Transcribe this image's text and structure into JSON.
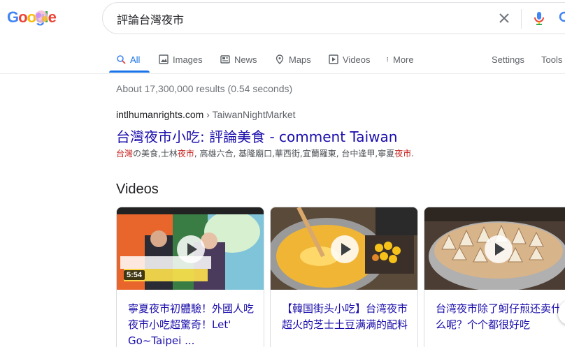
{
  "header": {
    "logo_letters": [
      "G",
      "o",
      "o",
      "g",
      "l",
      "e"
    ],
    "search_value": "評論台灣夜市"
  },
  "tabs": [
    {
      "label": "All",
      "icon": "search-icon",
      "active": true
    },
    {
      "label": "Images",
      "icon": "image-icon"
    },
    {
      "label": "News",
      "icon": "news-icon"
    },
    {
      "label": "Maps",
      "icon": "map-pin-icon"
    },
    {
      "label": "Videos",
      "icon": "play-square-icon"
    },
    {
      "label": "More",
      "icon": "more-vert-icon"
    }
  ],
  "tools": {
    "settings": "Settings",
    "tools": "Tools"
  },
  "stats": "About 17,300,000 results (0.54 seconds)",
  "result": {
    "domain": "intlhumanrights.com",
    "path": " › TaiwanNightMarket",
    "title": "台灣夜市小吃: 評論美食 - comment Taiwan",
    "snippet_parts": [
      {
        "t": "台灣",
        "hl": true
      },
      {
        "t": "の美食,士林",
        "hl": false
      },
      {
        "t": "夜市",
        "hl": true
      },
      {
        "t": ", 高雄六合, 基隆廟口,華西街,宜蘭羅東, 台中逢甲,寧夏",
        "hl": false
      },
      {
        "t": "夜市",
        "hl": true
      },
      {
        "t": ".",
        "hl": false
      }
    ]
  },
  "videos": {
    "heading": "Videos",
    "items": [
      {
        "title": "寧夏夜市初體驗！外國人吃夜市小吃超驚奇！Let' Go~Taipei ...",
        "duration": "5:54"
      },
      {
        "title": "【韓国街头小吃】台湾夜市超火的芝士土豆满满的配料"
      },
      {
        "title": "台湾夜市除了蚵仔煎还卖什么呢？个个都很好吃"
      }
    ]
  },
  "colors": {
    "accent": "#1a73e8",
    "link": "#1a0dab",
    "highlight": "#c5221f"
  }
}
